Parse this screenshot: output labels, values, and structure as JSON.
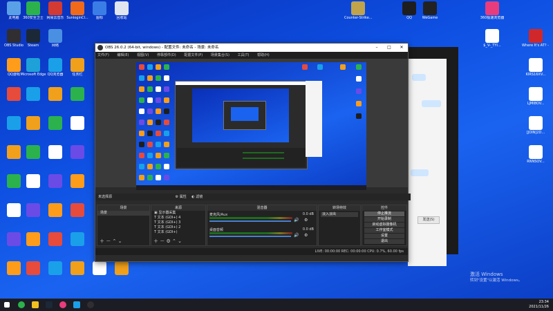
{
  "desktop_icons_left": [
    {
      "label": "此电脑",
      "color": "#5aa0e6"
    },
    {
      "label": "360安全卫士",
      "color": "#2bb24c"
    },
    {
      "label": "网易云音乐",
      "color": "#d33a31"
    },
    {
      "label": "SunloginCl...",
      "color": "#f06a1a"
    },
    {
      "label": "图标",
      "color": "#3b7de6"
    },
    {
      "label": "回收站",
      "color": "#dfe6f0"
    },
    {
      "label": "OBS Studio",
      "color": "#302e31"
    },
    {
      "label": "Steam",
      "color": "#1b2838"
    },
    {
      "label": "网络",
      "color": "#4a90e2"
    },
    {
      "label": "QQ游戏",
      "color": "#ff9c1a"
    },
    {
      "label": "Microsoft Edge",
      "color": "#1ea1d8"
    },
    {
      "label": "QQ浏览器",
      "color": "#1aa0e8"
    },
    {
      "label": "任务栏",
      "color": "#f0a01a"
    },
    {
      "label": "Counter-Strike...",
      "color": "#c0a34a"
    },
    {
      "label": "QQ",
      "color": "#1e1e1e"
    },
    {
      "label": "WeGame",
      "color": "#222222"
    }
  ],
  "obs": {
    "title": "OBS 26.0.2 (64-bit, windows) - 配置文件: 未命名 - 场景: 未命名",
    "menu": [
      "文件(F)",
      "编辑(E)",
      "视图(V)",
      "停靠部件(D)",
      "配置文件(P)",
      "场景集合(S)",
      "工具(T)",
      "帮助(H)"
    ],
    "source_bar": "未选择源",
    "source_bar_props": "属性",
    "source_bar_filters": "滤镜",
    "scenes_header": "场景",
    "scene_item": "场景",
    "sources_header": "来源",
    "sources": [
      "显示器采集",
      "文本 (GDI+) 4",
      "文本 (GDI+) 3",
      "文本 (GDI+) 2",
      "文本 (GDI+)"
    ],
    "mixer_header": "混音器",
    "mixer_tracks": [
      {
        "name": "麦克风/Aux",
        "level": "0.0 dB"
      },
      {
        "name": "桌面音频",
        "level": "0.0 dB"
      }
    ],
    "transitions_header": "转场特效",
    "transition_value": "淡入淡出",
    "controls_header": "控件",
    "controls": [
      "停止推流",
      "开始录制",
      "启动虚拟摄像机",
      "工作室模式",
      "设置",
      "退出"
    ],
    "status": "LIVE: 00:00:00   REC: 00:00:00   CPU: 0.7%, 60.00 fps"
  },
  "chat_window": {
    "button": "发送(S)"
  },
  "watermark": {
    "line1": "激活 Windows",
    "line2": "转到\"设置\"以激活 Windows。"
  },
  "taskbar": {
    "time": "23:34",
    "date": "2021/11/26"
  },
  "desktop_icons_right": [
    {
      "label": "360极速浏览器",
      "color": "#e83c7c"
    },
    {
      "label": "$_V-_TYl...",
      "color": "#ffffff"
    },
    {
      "label": "Where It's AT? - Mid...",
      "color": "#d0282a"
    },
    {
      "label": "KIRS16XV...",
      "color": "#ffffff"
    },
    {
      "label": "LJMI8OV...",
      "color": "#ffffff"
    },
    {
      "label": "[JOIN]2D...",
      "color": "#ffffff"
    },
    {
      "label": "RNNSOV...",
      "color": "#ffffff"
    }
  ]
}
